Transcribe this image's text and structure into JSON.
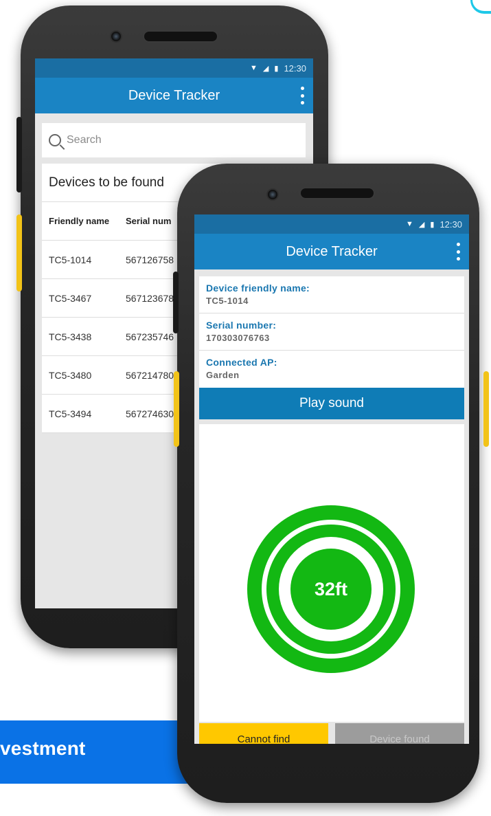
{
  "banner": {
    "text": "vestment"
  },
  "back_phone": {
    "status_time": "12:30",
    "app_title": "Device Tracker",
    "search_placeholder": "Search",
    "list_title": "Devices to be found",
    "columns": [
      "Friendly name",
      "Serial num"
    ],
    "rows": [
      [
        "TC5-1014",
        "567126758"
      ],
      [
        "TC5-3467",
        "567123678"
      ],
      [
        "TC5-3438",
        "567235746"
      ],
      [
        "TC5-3480",
        "567214780"
      ],
      [
        "TC5-3494",
        "567274630"
      ]
    ]
  },
  "front_phone": {
    "status_time": "12:30",
    "app_title": "Device Tracker",
    "friendly_name_label": "Device friendly name:",
    "friendly_name_value": "TC5-1014",
    "serial_label": "Serial number:",
    "serial_value": "170303076763",
    "ap_label": "Connected AP:",
    "ap_value": "Garden",
    "play_sound": "Play sound",
    "distance": "32ft",
    "cannot_find": "Cannot find",
    "device_found": "Device found"
  },
  "colors": {
    "status_bar": "#1a6ea3",
    "app_bar": "#1a84c4",
    "accent_blue": "#0f7cb6",
    "radar_green": "#13b813",
    "cannot_find": "#ffc800",
    "device_found_disabled": "#9c9c9c",
    "banner": "#0a72e6"
  }
}
